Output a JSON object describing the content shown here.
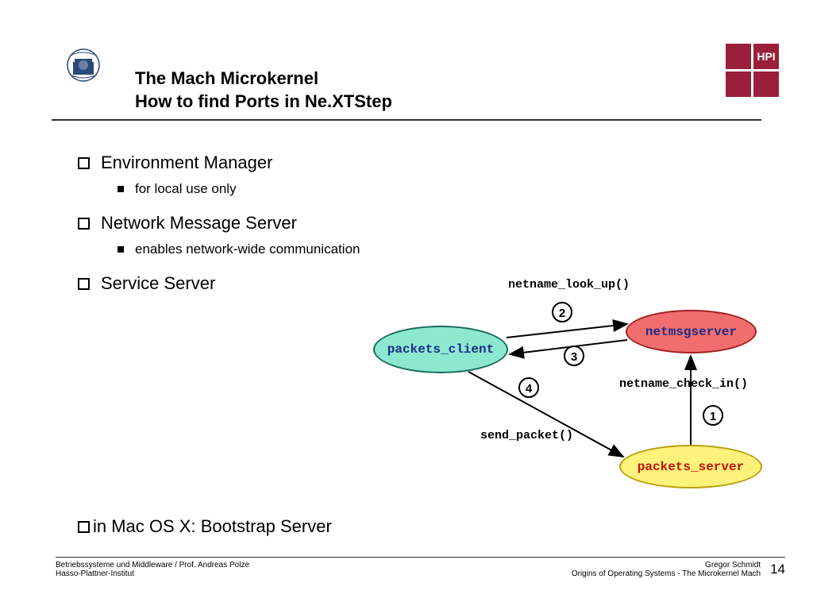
{
  "hpi_label": "HPI",
  "title": {
    "line1": "The Mach Microkernel",
    "line2": "How to find Ports in Ne.XTStep"
  },
  "bullets": {
    "b1": "Environment Manager",
    "b1_sub": "for local use only",
    "b2": "Network Message Server",
    "b2_sub": "enables network-wide communication",
    "b3": "Service Server",
    "b4": "in Mac OS X: Bootstrap Server"
  },
  "diagram": {
    "client": "packets_client",
    "msgserver": "netmsgserver",
    "server": "packets_server",
    "lookup": "netname_look_up()",
    "checkin": "netname_check_in()",
    "send": "send_packet()",
    "step1": "1",
    "step2": "2",
    "step3": "3",
    "step4": "4"
  },
  "footer": {
    "left1": "Betriebssysteme und Middleware / Prof. Andreas Polze",
    "left2": "Hasso-Plattner-Institut",
    "right1": "Gregor Schmidt",
    "right2": "Origins of Operating Systems - The Microkernel Mach",
    "page": "14"
  }
}
